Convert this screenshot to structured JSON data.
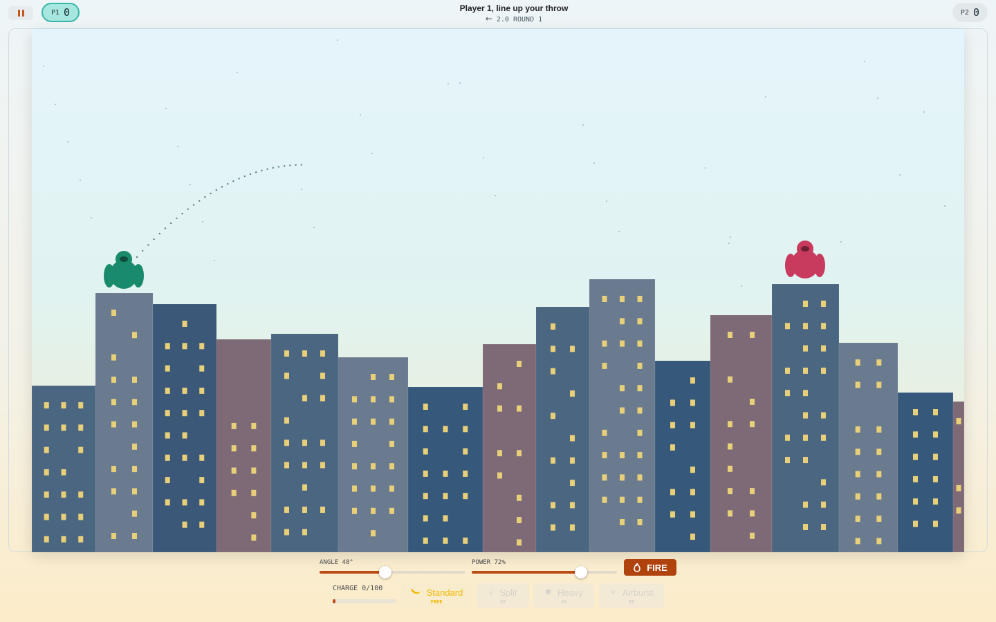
{
  "header": {
    "pause_label": "Pause",
    "p1": {
      "tag": "P1",
      "score": "0"
    },
    "p2": {
      "tag": "P2",
      "score": "0"
    },
    "turn_message": "Player 1, line up your throw",
    "wind_arrow": "←",
    "wind_value": "2.0",
    "round_label": "ROUND 1"
  },
  "controls": {
    "angle": {
      "label": "ANGLE 48°",
      "value": 48,
      "max": 90
    },
    "power": {
      "label": "POWER 72%",
      "value": 72,
      "max": 100
    },
    "fire_label": "FIRE",
    "charge": {
      "label": "CHARGE 0/100",
      "value": 0,
      "max": 100
    }
  },
  "ammo": [
    {
      "name": "Standard",
      "cost": "FREE",
      "icon": "banana-icon",
      "selected": true
    },
    {
      "name": "Split",
      "cost": "30",
      "icon": "split-icon",
      "selected": false
    },
    {
      "name": "Heavy",
      "cost": "30",
      "icon": "heavy-icon",
      "selected": false
    },
    {
      "name": "Airburst",
      "cost": "50",
      "icon": "airburst-icon",
      "selected": false
    }
  ],
  "colors": {
    "player1": "#1a8a6c",
    "player2": "#c83a5e",
    "accent": "#b0420e",
    "window": "#e8cf7a"
  },
  "players": [
    {
      "id": "P1",
      "color": "#1a8a6c",
      "building_index": 1
    },
    {
      "id": "P2",
      "color": "#c83a5e",
      "building_index": 12
    }
  ]
}
